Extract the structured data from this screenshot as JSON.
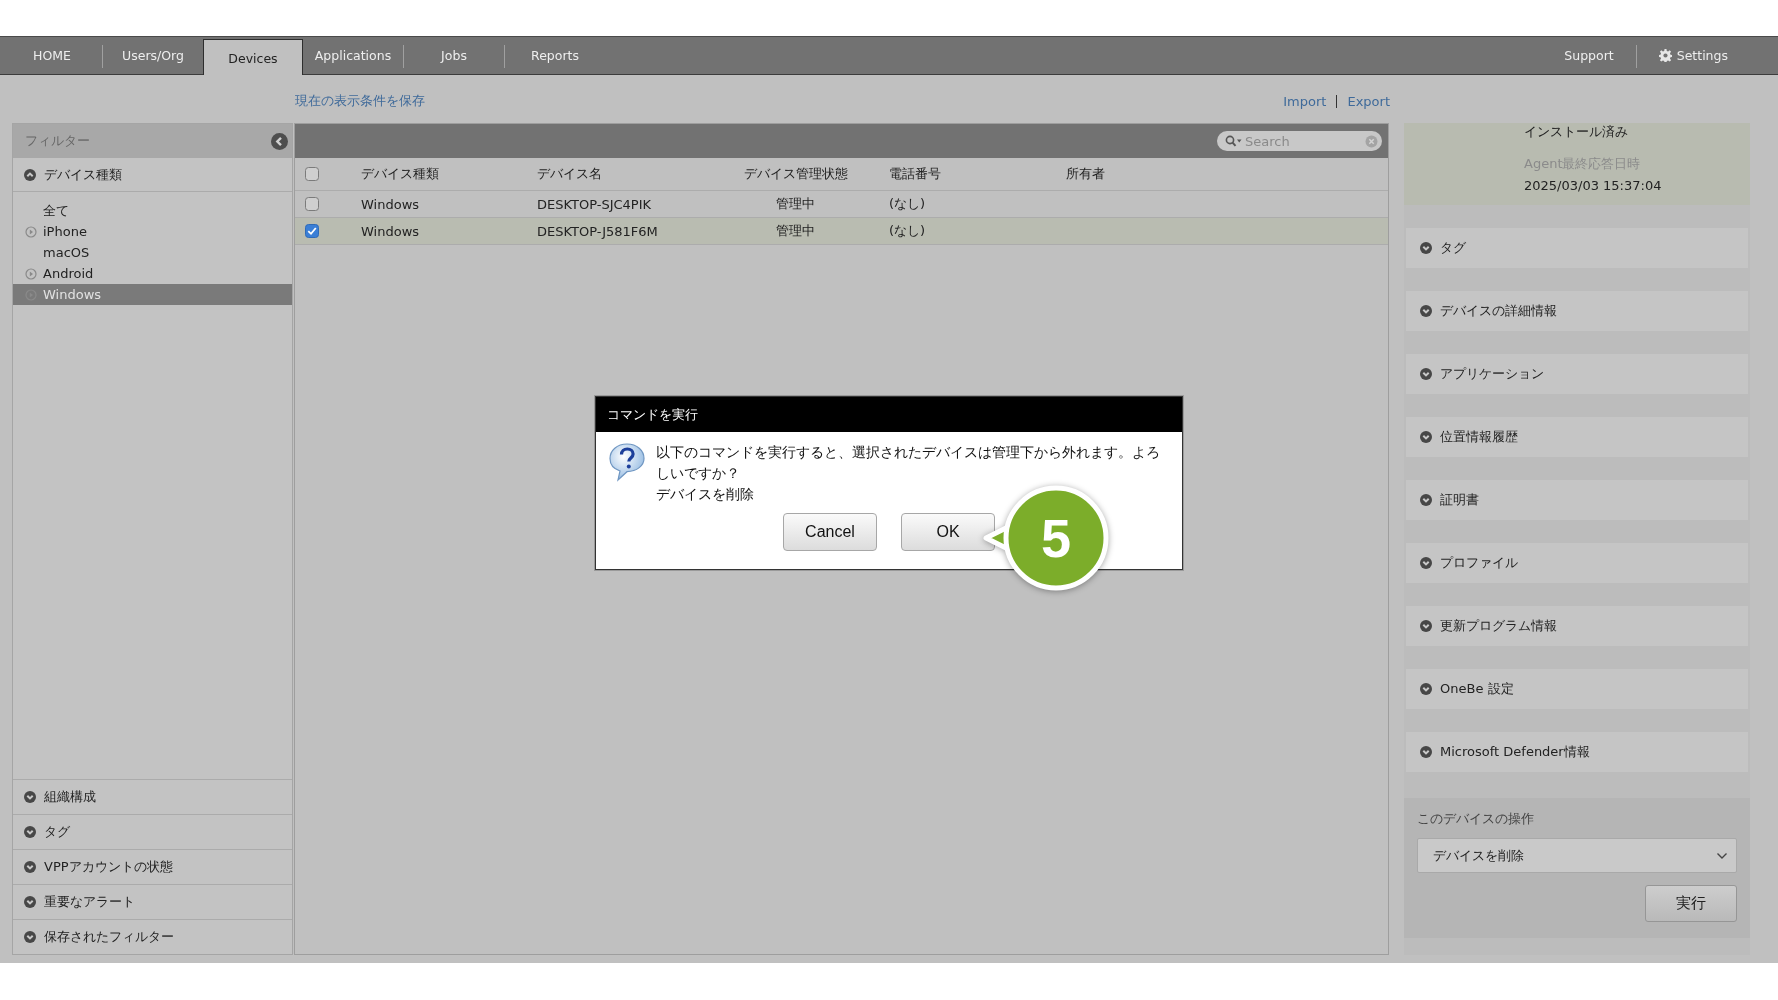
{
  "nav": {
    "tabs": [
      {
        "label": "HOME",
        "selected": false
      },
      {
        "label": "Users/Org",
        "selected": false
      },
      {
        "label": "Devices",
        "selected": true
      },
      {
        "label": "Applications",
        "selected": false
      },
      {
        "label": "Jobs",
        "selected": false
      },
      {
        "label": "Reports",
        "selected": false
      }
    ],
    "right": [
      {
        "label": "Support",
        "kind": "link"
      },
      {
        "label": "Settings",
        "kind": "gear"
      }
    ]
  },
  "save_view_link": "現在の表示条件を保存",
  "import_export": [
    "Import",
    "Export"
  ],
  "filter": {
    "title": "フィルター",
    "device_types": {
      "title": "デバイス種類",
      "expanded": true,
      "items": [
        {
          "label": "全て",
          "expandable": false,
          "selected": false
        },
        {
          "label": "iPhone",
          "expandable": true,
          "selected": false
        },
        {
          "label": "macOS",
          "expandable": false,
          "selected": false
        },
        {
          "label": "Android",
          "expandable": true,
          "selected": false
        },
        {
          "label": "Windows",
          "expandable": true,
          "selected": true
        }
      ]
    },
    "sections": [
      {
        "title": "組織構成",
        "expanded": false
      },
      {
        "title": "タグ",
        "expanded": false
      },
      {
        "title": "VPPアカウントの状態",
        "expanded": false
      },
      {
        "title": "重要なアラート",
        "expanded": false
      },
      {
        "title": "保存されたフィルター",
        "expanded": false
      }
    ]
  },
  "table": {
    "search": {
      "placeholder": "Search"
    },
    "all_checked": false,
    "columns": [
      "デバイス種類",
      "デバイス名",
      "デバイス管理状態",
      "電話番号",
      "所有者"
    ],
    "rows": [
      {
        "checked": false,
        "selected": false,
        "cells": [
          "Windows",
          "DESKTOP-SJC4PIK",
          "管理中",
          "(なし)"
        ]
      },
      {
        "checked": true,
        "selected": true,
        "cells": [
          "Windows",
          "DESKTOP-J581F6M",
          "管理中",
          "(なし)"
        ]
      }
    ]
  },
  "details": {
    "partial_value": "インストール済み",
    "fields": [
      {
        "label": "Agent最終応答日時",
        "value": "2025/03/03 15:37:04"
      }
    ],
    "sections": [
      {
        "title": "タグ",
        "expanded": false
      },
      {
        "title": "デバイスの詳細情報",
        "expanded": false
      },
      {
        "title": "アプリケーション",
        "expanded": false
      },
      {
        "title": "位置情報履歴",
        "expanded": false
      },
      {
        "title": "証明書",
        "expanded": false
      },
      {
        "title": "プロファイル",
        "expanded": false
      },
      {
        "title": "更新プログラム情報",
        "expanded": false
      },
      {
        "title": "OneBe 設定",
        "expanded": false
      },
      {
        "title": "Microsoft Defender情報",
        "expanded": false
      }
    ],
    "operations": {
      "title": "このデバイスの操作",
      "select": "デバイスを削除",
      "button": "実行"
    }
  },
  "dialog": {
    "title": "コマンドを実行",
    "message": "以下のコマンドを実行すると、選択されたデバイスは管理下から外れます。よろしいですか？",
    "command": "デバイスを削除",
    "buttons": [
      "Cancel",
      "OK"
    ]
  },
  "step_badge": "5"
}
